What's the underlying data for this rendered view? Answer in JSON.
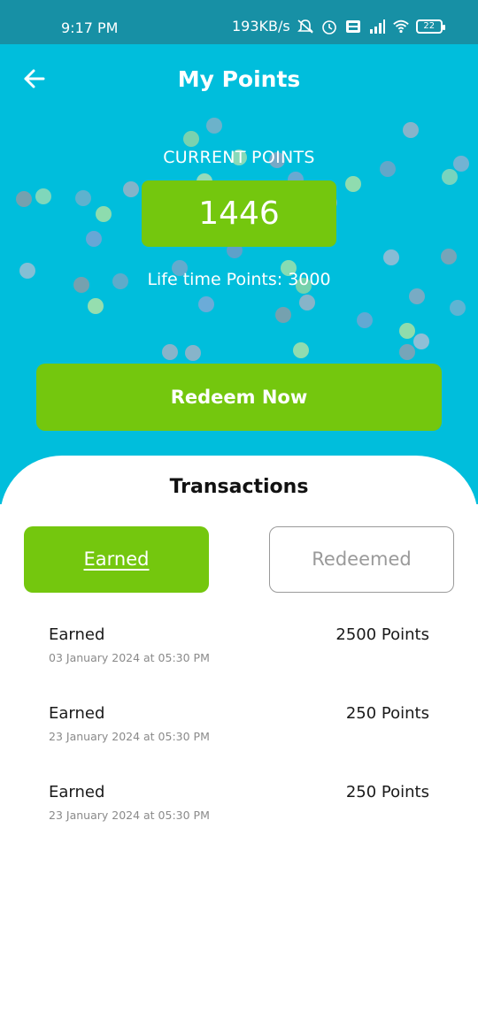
{
  "status_bar": {
    "time": "9:17 PM",
    "speed": "193KB/s",
    "battery": "22",
    "icons": [
      "mute-alarm-icon",
      "alarm-icon",
      "volte-icon",
      "signal-icon",
      "wifi-icon",
      "battery-icon"
    ]
  },
  "header": {
    "title": "My Points",
    "back_icon": "arrow-left-icon"
  },
  "points": {
    "current_label": "CURRENT POINTS",
    "current_value": "1446",
    "lifetime_text": "Life time Points: 3000"
  },
  "redeem_button": {
    "label": "Redeem Now"
  },
  "transactions": {
    "title": "Transactions",
    "tabs": [
      {
        "label": "Earned",
        "active": true
      },
      {
        "label": "Redeemed",
        "active": false
      }
    ],
    "items": [
      {
        "type": "Earned",
        "date": "03 January 2024 at 05:30 PM",
        "points": "2500 Points"
      },
      {
        "type": "Earned",
        "date": "23 January 2024 at 05:30 PM",
        "points": "250 Points"
      },
      {
        "type": "Earned",
        "date": "23 January 2024 at 05:30 PM",
        "points": "250 Points"
      }
    ]
  },
  "colors": {
    "status_bar": "#1790a5",
    "hero_bg": "#00bedc",
    "accent_green": "#74c70e",
    "inactive_border": "#9a9a9a"
  }
}
